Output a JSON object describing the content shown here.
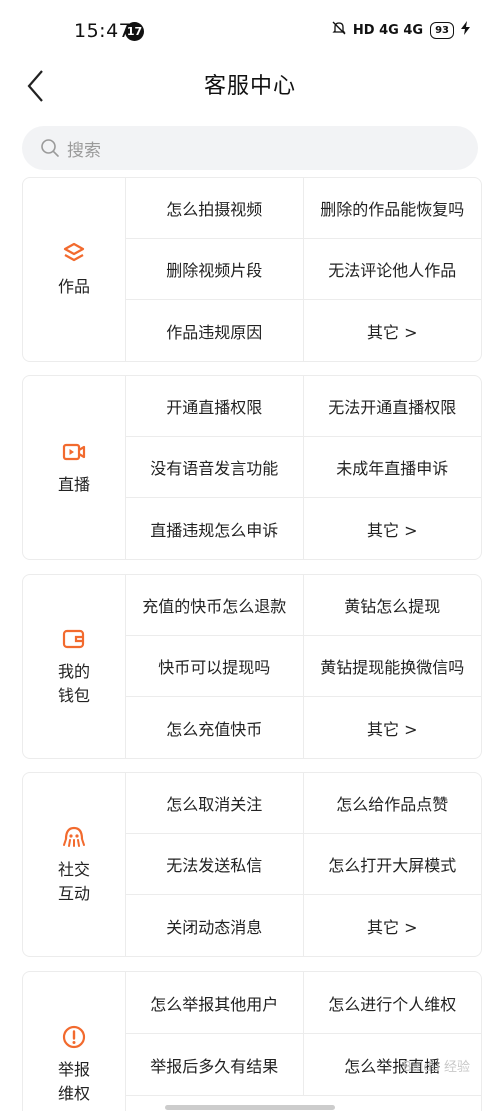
{
  "status_bar": {
    "time": "15:47",
    "notification_count": "17",
    "indicators": "HD 4G 4G",
    "battery": "93"
  },
  "header": {
    "title": "客服中心"
  },
  "search": {
    "placeholder": "搜索"
  },
  "accent_color": "#f26a2e",
  "sections": [
    {
      "name": "作品",
      "icon": "layers-icon",
      "items": [
        "怎么拍摄视频",
        "删除的作品能恢复吗",
        "删除视频片段",
        "无法评论他人作品",
        "作品违规原因",
        "其它 >"
      ]
    },
    {
      "name": "直播",
      "icon": "live-camera-icon",
      "items": [
        "开通直播权限",
        "无法开通直播权限",
        "没有语音发言功能",
        "未成年直播申诉",
        "直播违规怎么申诉",
        "其它 >"
      ]
    },
    {
      "name": "我的\n钱包",
      "icon": "wallet-icon",
      "items": [
        "充值的快币怎么退款",
        "黄钻怎么提现",
        "快币可以提现吗",
        "黄钻提现能换微信吗",
        "怎么充值快币",
        "其它 >"
      ]
    },
    {
      "name": "社交\n互动",
      "icon": "social-icon",
      "items": [
        "怎么取消关注",
        "怎么给作品点赞",
        "无法发送私信",
        "怎么打开大屏模式",
        "关闭动态消息",
        "其它 >"
      ]
    },
    {
      "name": "举报\n维权",
      "icon": "alert-icon",
      "items": [
        "怎么举报其他用户",
        "怎么进行个人维权",
        "举报后多久有结果",
        "怎么举报直播"
      ]
    }
  ],
  "watermark": "Baidu 经验"
}
